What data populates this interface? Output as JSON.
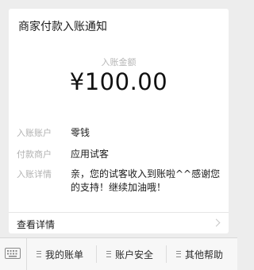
{
  "message": {
    "title": "商家付款入账通知",
    "amount_label": "入账金额",
    "amount": "¥100.00",
    "fields": [
      {
        "key": "入账账户",
        "value": "零钱"
      },
      {
        "key": "付款商户",
        "value": "应用试客"
      },
      {
        "key": "入账详情",
        "value": "亲，您的试客收入到账啦^^感谢您的支持！继续加油哦！"
      }
    ],
    "details_link": "查看详情"
  },
  "toolbar": {
    "keyboard_icon": "keyboard-icon",
    "items": [
      "我的账单",
      "账户安全",
      "其他帮助"
    ]
  },
  "colors": {
    "background": "#ededed",
    "card": "#ffffff",
    "label_gray": "#b1b1b1"
  }
}
